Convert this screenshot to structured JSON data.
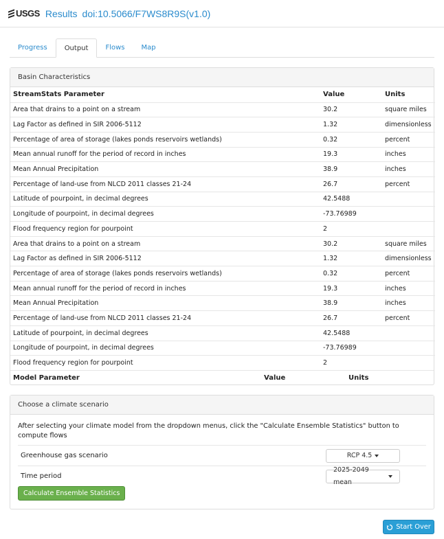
{
  "header": {
    "logo": "USGS",
    "title": "Results",
    "doi": "doi:10.5066/F7WS8R9S(v1.0)"
  },
  "tabs": [
    {
      "label": "Progress"
    },
    {
      "label": "Output"
    },
    {
      "label": "Flows"
    },
    {
      "label": "Map"
    }
  ],
  "basin": {
    "heading": "Basin Characteristics",
    "col_param": "StreamStats Parameter",
    "col_value": "Value",
    "col_units": "Units",
    "rows": [
      {
        "param": "Area that drains to a point on a stream",
        "value": "30.2",
        "units": "square miles"
      },
      {
        "param": "Lag Factor as defined in SIR 2006-5112",
        "value": "1.32",
        "units": "dimensionless"
      },
      {
        "param": "Percentage of area of storage (lakes ponds reservoirs wetlands)",
        "value": "0.32",
        "units": "percent"
      },
      {
        "param": "Mean annual runoff for the period of record in inches",
        "value": "19.3",
        "units": "inches"
      },
      {
        "param": "Mean Annual Precipitation",
        "value": "38.9",
        "units": "inches"
      },
      {
        "param": "Percentage of land-use from NLCD 2011 classes 21-24",
        "value": "26.7",
        "units": "percent"
      },
      {
        "param": "Latitude of pourpoint, in decimal degrees",
        "value": "42.5488",
        "units": ""
      },
      {
        "param": "Longitude of pourpoint, in decimal degrees",
        "value": "-73.76989",
        "units": ""
      },
      {
        "param": "Flood frequency region for pourpoint",
        "value": "2",
        "units": ""
      },
      {
        "param": "Area that drains to a point on a stream",
        "value": "30.2",
        "units": "square miles"
      },
      {
        "param": "Lag Factor as defined in SIR 2006-5112",
        "value": "1.32",
        "units": "dimensionless"
      },
      {
        "param": "Percentage of area of storage (lakes ponds reservoirs wetlands)",
        "value": "0.32",
        "units": "percent"
      },
      {
        "param": "Mean annual runoff for the period of record in inches",
        "value": "19.3",
        "units": "inches"
      },
      {
        "param": "Mean Annual Precipitation",
        "value": "38.9",
        "units": "inches"
      },
      {
        "param": "Percentage of land-use from NLCD 2011 classes 21-24",
        "value": "26.7",
        "units": "percent"
      },
      {
        "param": "Latitude of pourpoint, in decimal degrees",
        "value": "42.5488",
        "units": ""
      },
      {
        "param": "Longitude of pourpoint, in decimal degrees",
        "value": "-73.76989",
        "units": ""
      },
      {
        "param": "Flood frequency region for pourpoint",
        "value": "2",
        "units": ""
      }
    ],
    "model_param": "Model Parameter",
    "model_value": "Value",
    "model_units": "Units"
  },
  "climate": {
    "heading": "Choose a climate scenario",
    "instructions": "After selecting your climate model from the dropdown menus, click the \"Calculate Ensemble Statistics\" button to compute flows",
    "ghg_label": "Greenhouse gas scenario",
    "ghg_value": "RCP 4.5",
    "period_label": "Time period",
    "period_value": "2025-2049 mean",
    "calc_button": "Calculate Ensemble Statistics"
  },
  "start_over": "Start Over",
  "colors": {
    "link": "#2a8bcd",
    "calc_button": "#6ab04c",
    "start_button": "#2a9fd6"
  }
}
